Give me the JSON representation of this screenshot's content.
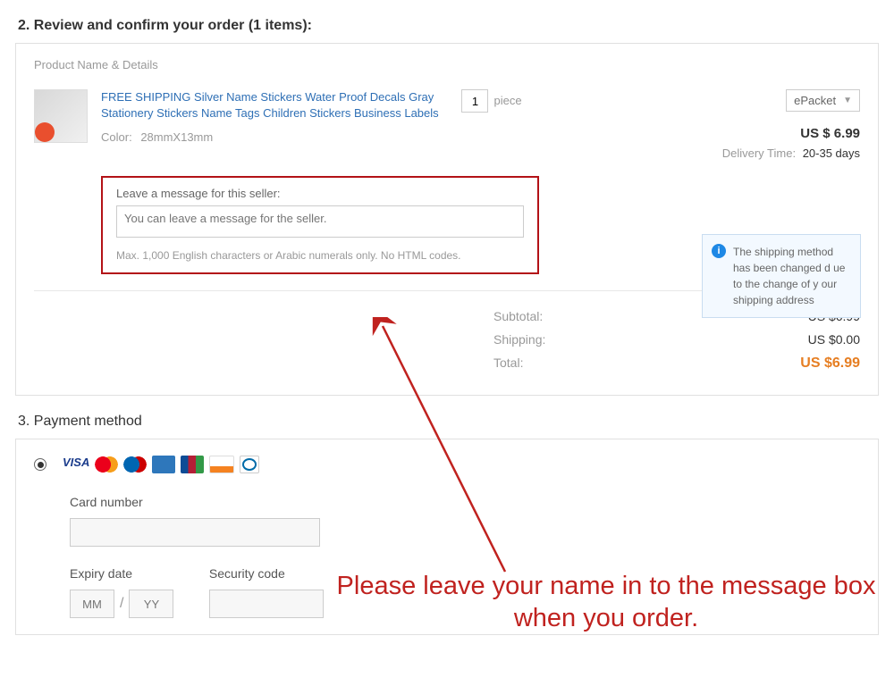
{
  "section2": {
    "title": "2. Review and confirm your order (1 items):",
    "header_label": "Product Name & Details",
    "product": {
      "title": "FREE SHIPPING Silver Name Stickers Water Proof Decals Gray Stationery Stickers Name Tags Children Stickers Business Labels",
      "color_label": "Color:",
      "color_value": "28mmX13mm"
    },
    "qty": {
      "value": "1",
      "unit": "piece"
    },
    "shipping_method": "ePacket",
    "price": "US $ 6.99",
    "delivery_time_label": "Delivery Time:",
    "delivery_time_value": "20-35 days",
    "message": {
      "label": "Leave a message for this seller:",
      "placeholder": "You can leave a message for the seller.",
      "hint": "Max. 1,000 English characters or Arabic numerals only. No HTML codes."
    },
    "shipping_note": "The shipping method has been changed d ue to the change of y our shipping address",
    "totals": {
      "subtotal_label": "Subtotal:",
      "subtotal_value": "US $6.99",
      "shipping_label": "Shipping:",
      "shipping_value": "US $0.00",
      "total_label": "Total:",
      "total_value": "US $6.99"
    }
  },
  "section3": {
    "title": "3. Payment method",
    "card_number_label": "Card number",
    "expiry_label": "Expiry date",
    "security_label": "Security code",
    "mm_placeholder": "MM",
    "yy_placeholder": "YY",
    "slash": "/"
  },
  "annotation": "Please leave your name in to the message box when you order."
}
